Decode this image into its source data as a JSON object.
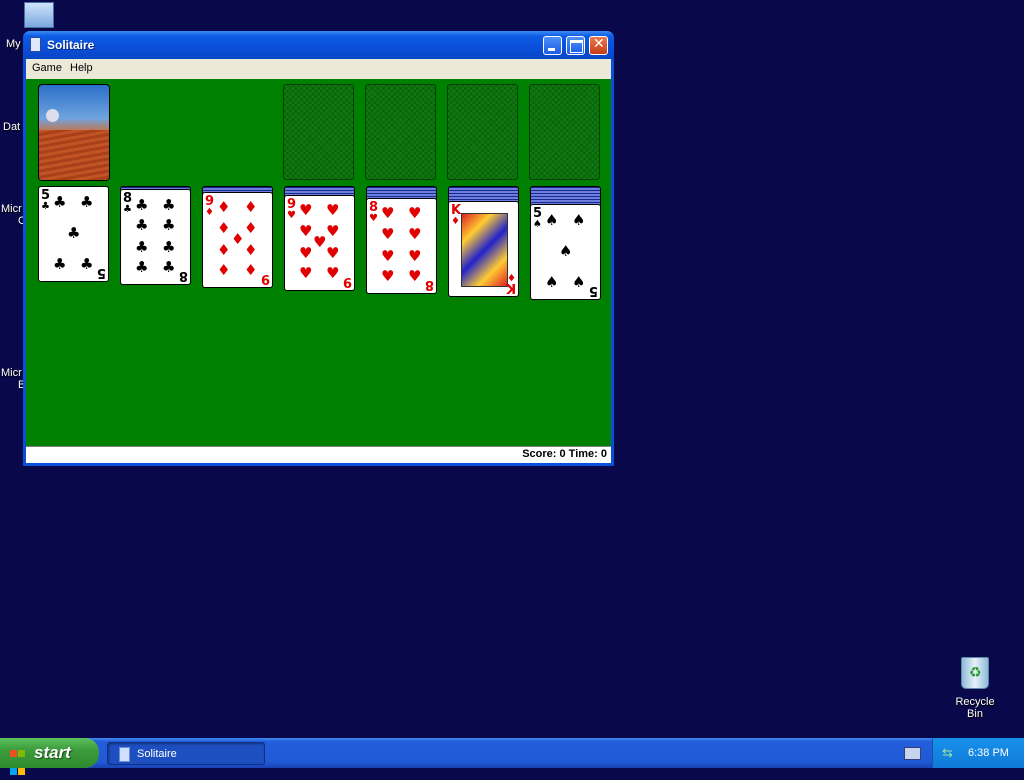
{
  "desktop": {
    "icons": [
      {
        "label": "My"
      },
      {
        "label": "Dat"
      },
      {
        "label": "Micr"
      },
      {
        "label": "C"
      },
      {
        "label": "Micr"
      },
      {
        "label": "B"
      }
    ],
    "recycle_bin": {
      "label": "Recycle Bin"
    }
  },
  "window": {
    "title": "Solitaire",
    "menu": [
      "Game",
      "Help"
    ],
    "status": "Score: 0 Time: 0"
  },
  "tableau": [
    {
      "rank": "5",
      "suit": "♣",
      "color": "black"
    },
    {
      "rank": "8",
      "suit": "♣",
      "color": "black"
    },
    {
      "rank": "9",
      "suit": "♦",
      "color": "red"
    },
    {
      "rank": "9",
      "suit": "♥",
      "color": "red"
    },
    {
      "rank": "8",
      "suit": "♥",
      "color": "red"
    },
    {
      "rank": "K",
      "suit": "♦",
      "color": "red"
    },
    {
      "rank": "5",
      "suit": "♠",
      "color": "black"
    }
  ],
  "taskbar": {
    "start_label": "start",
    "task_label": "Solitaire",
    "clock": "6:38 PM"
  },
  "icons": {
    "app": "solitaire-icon",
    "minimize": "minimize-icon",
    "maximize": "maximize-icon",
    "close": "close-icon",
    "start": "windows-flag-icon",
    "recycle": "recycle-bin-icon",
    "network": "network-icon",
    "keyboard": "keyboard-icon"
  },
  "colors": {
    "felt": "#008000",
    "desktop": "#08084a",
    "titlebar": "#0a4fd8",
    "red_suit": "#e00000"
  }
}
